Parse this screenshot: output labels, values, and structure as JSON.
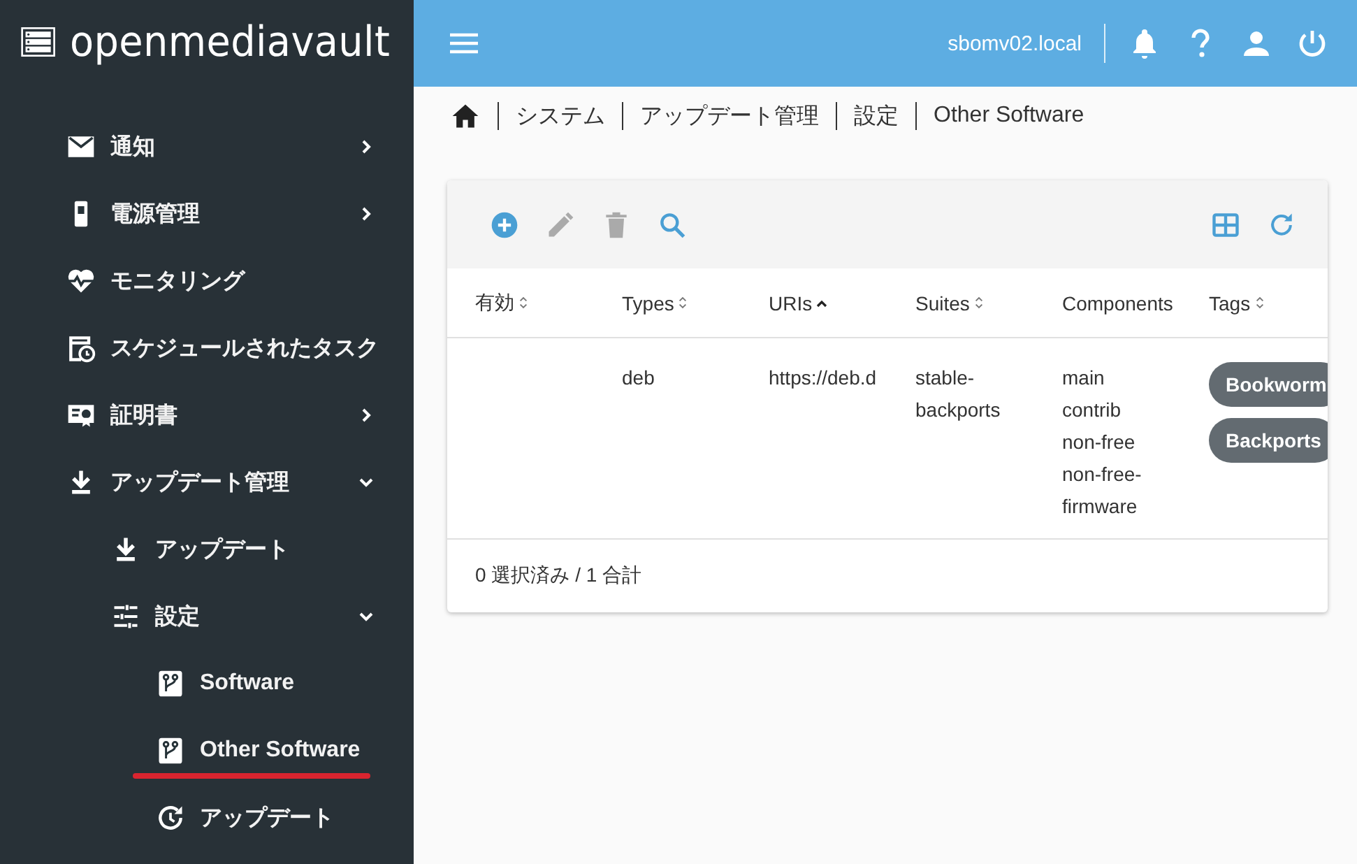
{
  "logo": {
    "text": "openmediavault"
  },
  "sidebar": {
    "items": [
      {
        "label": "通知",
        "expanded": false,
        "selected": false
      },
      {
        "label": "電源管理",
        "expanded": false,
        "selected": false
      },
      {
        "label": "モニタリング",
        "selected": false
      },
      {
        "label": "スケジュールされたタスク",
        "selected": false
      },
      {
        "label": "証明書",
        "expanded": false,
        "selected": false
      },
      {
        "label": "アップデート管理",
        "expanded": true,
        "selected": false,
        "children": [
          {
            "label": "アップデート",
            "selected": false
          },
          {
            "label": "設定",
            "expanded": true,
            "selected": false,
            "children": [
              {
                "label": "Software",
                "selected": false
              },
              {
                "label": "Other Software",
                "selected": true
              },
              {
                "label": "アップデート",
                "selected": false
              }
            ]
          }
        ]
      }
    ]
  },
  "header": {
    "hostname": "sbomv02.local"
  },
  "breadcrumb": [
    "システム",
    "アップデート管理",
    "設定",
    "Other Software"
  ],
  "toolbar": {
    "buttons": [
      {
        "disabled": false
      },
      {
        "disabled": true
      },
      {
        "disabled": true
      },
      {
        "disabled": false
      }
    ],
    "right_buttons": [
      {
        "disabled": false
      },
      {
        "disabled": false
      }
    ]
  },
  "table": {
    "columns": [
      {
        "label": "有効",
        "sortable": true,
        "sorted": false
      },
      {
        "label": "Types",
        "sortable": true,
        "sorted": false
      },
      {
        "label": "URIs",
        "sortable": true,
        "sorted": true
      },
      {
        "label": "Suites",
        "sortable": true,
        "sorted": false
      },
      {
        "label": "Components",
        "sortable": false,
        "sorted": false
      },
      {
        "label": "Tags",
        "sortable": true,
        "sorted": false
      }
    ],
    "rows": [
      {
        "types": "deb",
        "uris": "https://deb.d",
        "suites": "stable-backports",
        "components": [
          "main",
          "contrib",
          "non-free",
          "non-free-firmware"
        ],
        "tags": [
          "Bookworm",
          "Backports"
        ]
      }
    ],
    "footer": "0 選択済み / 1 合計"
  }
}
